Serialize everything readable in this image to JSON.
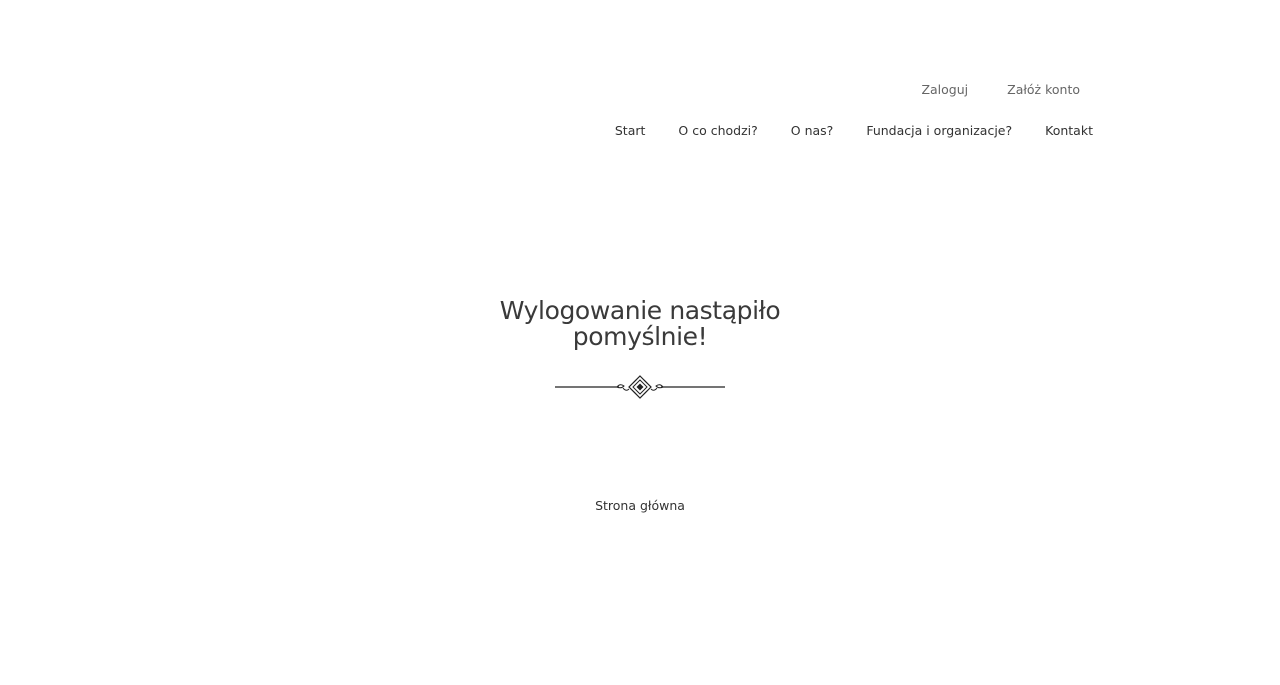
{
  "account": {
    "login_label": "Zaloguj",
    "register_label": "Załóż konto"
  },
  "nav": {
    "items": [
      {
        "label": "Start"
      },
      {
        "label": "O co chodzi?"
      },
      {
        "label": "O nas?"
      },
      {
        "label": "Fundacja i organizacje?"
      },
      {
        "label": "Kontakt"
      }
    ]
  },
  "main": {
    "title": "Wylogowanie nastąpiło pomyślnie!",
    "divider_icon": "ornamental-divider-icon",
    "home_link_label": "Strona główna"
  }
}
